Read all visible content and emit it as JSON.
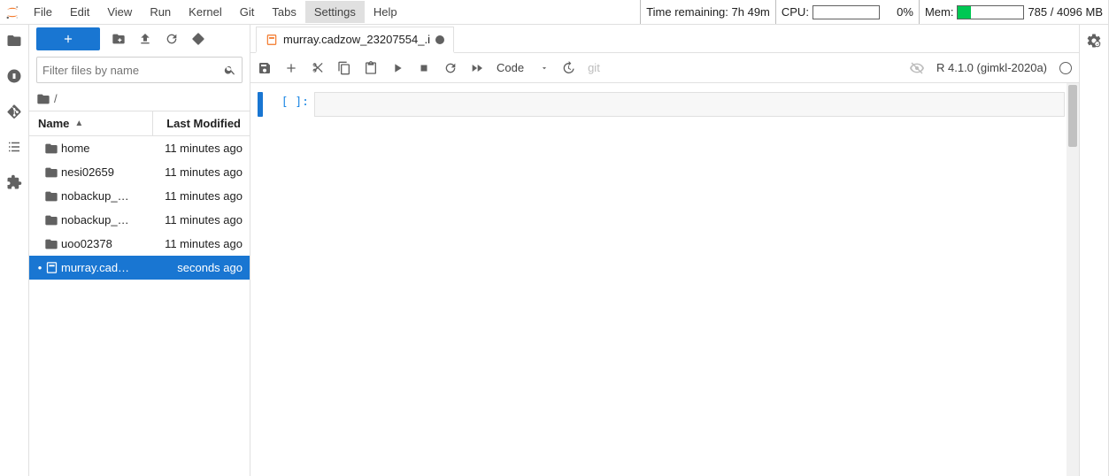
{
  "menu": {
    "items": [
      "File",
      "Edit",
      "View",
      "Run",
      "Kernel",
      "Git",
      "Tabs",
      "Settings",
      "Help"
    ],
    "active": "Settings"
  },
  "status": {
    "time_label": "Time remaining: 7h 49m",
    "cpu_label": "CPU:",
    "cpu_pct": "0%",
    "mem_label": "Mem:",
    "mem_text": "785 / 4096 MB"
  },
  "files": {
    "filter_placeholder": "Filter files by name",
    "breadcrumb_root": "/",
    "header_name": "Name",
    "header_modified": "Last Modified",
    "rows": [
      {
        "kind": "folder",
        "name": "home",
        "mod": "11 minutes ago",
        "selected": false,
        "running": false
      },
      {
        "kind": "folder",
        "name": "nesi02659",
        "mod": "11 minutes ago",
        "selected": false,
        "running": false
      },
      {
        "kind": "folder",
        "name": "nobackup_…",
        "mod": "11 minutes ago",
        "selected": false,
        "running": false
      },
      {
        "kind": "folder",
        "name": "nobackup_…",
        "mod": "11 minutes ago",
        "selected": false,
        "running": false
      },
      {
        "kind": "folder",
        "name": "uoo02378",
        "mod": "11 minutes ago",
        "selected": false,
        "running": false
      },
      {
        "kind": "notebook",
        "name": "murray.cad…",
        "mod": "seconds ago",
        "selected": true,
        "running": true
      }
    ]
  },
  "tab": {
    "title": "murray.cadzow_23207554_.i"
  },
  "nbtoolbar": {
    "cell_type": "Code",
    "git_label": "git"
  },
  "kernel": {
    "name": "R 4.1.0 (gimkl-2020a)"
  },
  "cell": {
    "prompt": "[ ]:"
  }
}
